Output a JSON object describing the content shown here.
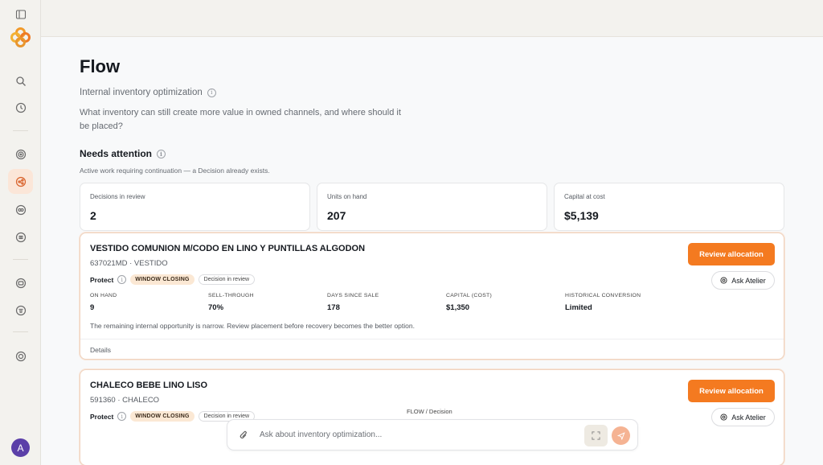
{
  "page": {
    "title": "Flow",
    "subtitle": "Internal inventory optimization",
    "question": "What inventory can still create more value in owned channels, and where should it be placed?"
  },
  "section": {
    "title": "Needs attention",
    "description": "Active work requiring continuation — a Decision already exists."
  },
  "stats": [
    {
      "label": "Decisions in review",
      "value": "2"
    },
    {
      "label": "Units on hand",
      "value": "207"
    },
    {
      "label": "Capital at cost",
      "value": "$5,139"
    }
  ],
  "cards": [
    {
      "name": "VESTIDO COMUNION M/CODO EN LINO Y PUNTILLAS ALGODON",
      "sku": "637021MD · VESTIDO",
      "protect": "Protect",
      "warning_tag": "WINDOW CLOSING",
      "status_tag": "Decision in review",
      "review_label": "Review allocation",
      "ask_label": "Ask Atelier",
      "metrics": [
        {
          "label": "ON HAND",
          "value": "9"
        },
        {
          "label": "SELL-THROUGH",
          "value": "70%"
        },
        {
          "label": "DAYS SINCE SALE",
          "value": "178"
        },
        {
          "label": "CAPITAL (COST)",
          "value": "$1,350"
        },
        {
          "label": "HISTORICAL CONVERSION",
          "value": "Limited"
        }
      ],
      "note": "The remaining internal opportunity is narrow. Review placement before recovery becomes the better option.",
      "details_label": "Details"
    },
    {
      "name": "CHALECO BEBE LINO LISO",
      "sku": "591360 · CHALECO",
      "protect": "Protect",
      "warning_tag": "WINDOW CLOSING",
      "status_tag": "Decision in review",
      "flow_label": "FLOW / Decision",
      "review_label": "Review allocation",
      "ask_label": "Ask Atelier"
    }
  ],
  "chat": {
    "placeholder": "Ask about inventory optimization..."
  },
  "user": {
    "initial": "A"
  },
  "colors": {
    "accent": "#f47a20",
    "active_nav_bg": "#fbe6d8",
    "avatar": "#5b3fa8"
  }
}
